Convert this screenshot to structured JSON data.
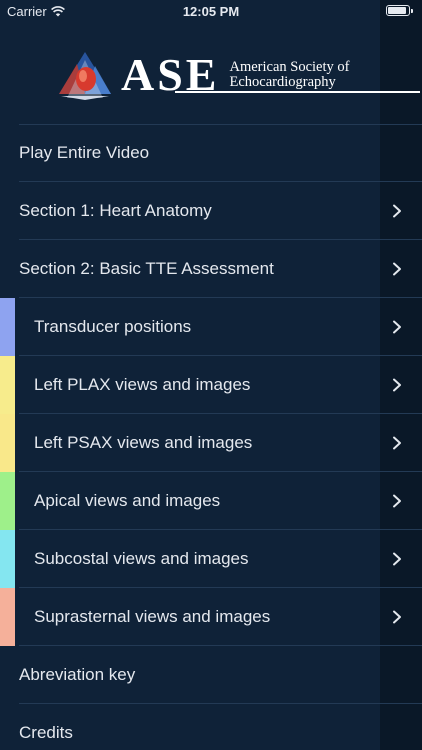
{
  "status_bar": {
    "carrier": "Carrier",
    "time": "12:05 PM",
    "wifi_icon": "wifi-icon",
    "battery_icon": "battery-icon"
  },
  "logo": {
    "mark_icon": "ase-heart-logo-icon",
    "abbreviation": "ASE",
    "line1": "American Society of",
    "line2": "Echocardiography"
  },
  "menu": {
    "items": [
      {
        "label": "Play Entire Video",
        "chevron": false,
        "indent": false,
        "color": null
      },
      {
        "label": "Section 1: Heart Anatomy",
        "chevron": true,
        "indent": false,
        "color": null
      },
      {
        "label": "Section 2: Basic TTE Assessment",
        "chevron": true,
        "indent": false,
        "color": null
      },
      {
        "label": "Transducer positions",
        "chevron": true,
        "indent": true,
        "color": "#8ea3f0"
      },
      {
        "label": "Left PLAX views and images",
        "chevron": true,
        "indent": true,
        "color": "#f7ec8c"
      },
      {
        "label": "Left PSAX views and images",
        "chevron": true,
        "indent": true,
        "color": "#f9e88a"
      },
      {
        "label": "Apical views and images",
        "chevron": true,
        "indent": true,
        "color": "#9ef08a"
      },
      {
        "label": "Subcostal views and images",
        "chevron": true,
        "indent": true,
        "color": "#84e6f0"
      },
      {
        "label": "Suprasternal views and images",
        "chevron": true,
        "indent": true,
        "color": "#f5b09a"
      },
      {
        "label": "Abreviation key",
        "chevron": false,
        "indent": false,
        "color": null
      },
      {
        "label": "Credits",
        "chevron": false,
        "indent": false,
        "color": null
      }
    ]
  },
  "colors": {
    "background": "#0f2238",
    "right_panel": "#0a1828",
    "text": "#e4e8ee",
    "separator": "#233a55"
  }
}
